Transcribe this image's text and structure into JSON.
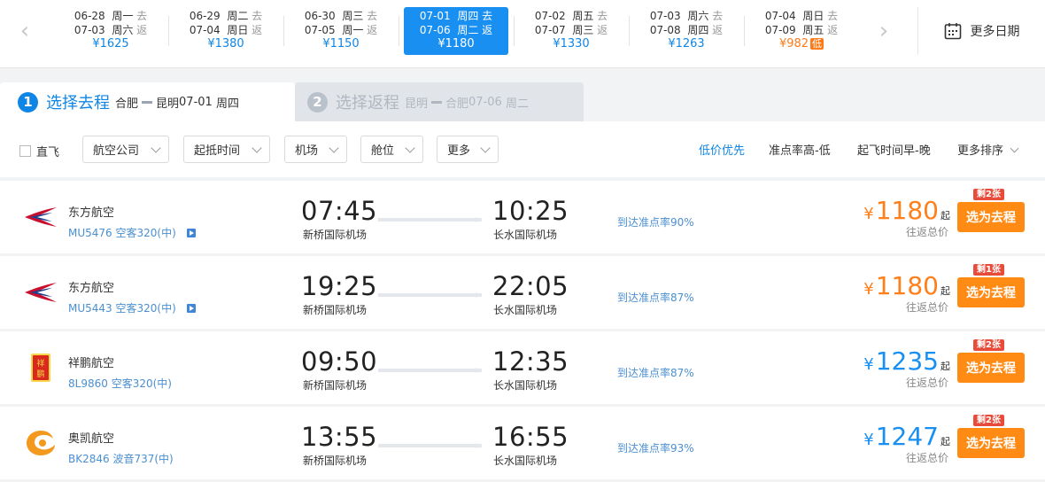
{
  "date_strip": {
    "items": [
      {
        "out_date": "06-28",
        "out_day": "周一",
        "out_dir": "去",
        "ret_date": "07-03",
        "ret_day": "周六",
        "ret_dir": "返",
        "price": "¥1625",
        "active": false,
        "low": false
      },
      {
        "out_date": "06-29",
        "out_day": "周二",
        "out_dir": "去",
        "ret_date": "07-04",
        "ret_day": "周日",
        "ret_dir": "返",
        "price": "¥1380",
        "active": false,
        "low": false
      },
      {
        "out_date": "06-30",
        "out_day": "周三",
        "out_dir": "去",
        "ret_date": "07-05",
        "ret_day": "周一",
        "ret_dir": "返",
        "price": "¥1150",
        "active": false,
        "low": false
      },
      {
        "out_date": "07-01",
        "out_day": "周四",
        "out_dir": "去",
        "ret_date": "07-06",
        "ret_day": "周二",
        "ret_dir": "返",
        "price": "¥1180",
        "active": true,
        "low": false
      },
      {
        "out_date": "07-02",
        "out_day": "周五",
        "out_dir": "去",
        "ret_date": "07-07",
        "ret_day": "周三",
        "ret_dir": "返",
        "price": "¥1330",
        "active": false,
        "low": false
      },
      {
        "out_date": "07-03",
        "out_day": "周六",
        "out_dir": "去",
        "ret_date": "07-08",
        "ret_day": "周四",
        "ret_dir": "返",
        "price": "¥1263",
        "active": false,
        "low": false
      },
      {
        "out_date": "07-04",
        "out_day": "周日",
        "out_dir": "去",
        "ret_date": "07-09",
        "ret_day": "周五",
        "ret_dir": "返",
        "price": "¥982",
        "active": false,
        "low": true,
        "low_label": "低"
      }
    ],
    "more_dates_label": "更多日期"
  },
  "steps": {
    "step1": {
      "num": "1",
      "title": "选择去程",
      "from": "合肥",
      "to": "昆明",
      "date": "07-01",
      "day": "周四"
    },
    "step2": {
      "num": "2",
      "title": "选择返程",
      "from": "昆明",
      "to": "合肥",
      "date": "07-06",
      "day": "周二"
    }
  },
  "filters": {
    "direct_label": "直飞",
    "buttons": [
      "航空公司",
      "起抵时间",
      "机场",
      "舱位",
      "更多"
    ],
    "sorts": [
      "低价优先",
      "准点率高-低",
      "起飞时间早-晚",
      "更多排序"
    ]
  },
  "flights": [
    {
      "airline": "东方航空",
      "flight_no": "MU5476",
      "aircraft": "空客320(中)",
      "has_video": true,
      "dep_time": "07:45",
      "dep_airport": "新桥国际机场",
      "arr_time": "10:25",
      "arr_airport": "长水国际机场",
      "ontime": "到达准点率90%",
      "price": "1180",
      "price_suffix": "起",
      "price_color": "orange",
      "price_note": "往返总价",
      "seats": "剩2张",
      "button": "选为去程",
      "logo": "china-eastern"
    },
    {
      "airline": "东方航空",
      "flight_no": "MU5443",
      "aircraft": "空客320(中)",
      "has_video": true,
      "dep_time": "19:25",
      "dep_airport": "新桥国际机场",
      "arr_time": "22:05",
      "arr_airport": "长水国际机场",
      "ontime": "到达准点率87%",
      "price": "1180",
      "price_suffix": "起",
      "price_color": "orange",
      "price_note": "往返总价",
      "seats": "剩1张",
      "button": "选为去程",
      "logo": "china-eastern"
    },
    {
      "airline": "祥鹏航空",
      "flight_no": "8L9860",
      "aircraft": "空客320(中)",
      "has_video": false,
      "dep_time": "09:50",
      "dep_airport": "新桥国际机场",
      "arr_time": "12:35",
      "arr_airport": "长水国际机场",
      "ontime": "到达准点率87%",
      "price": "1235",
      "price_suffix": "起",
      "price_color": "blue",
      "price_note": "往返总价",
      "seats": "剩2张",
      "button": "选为去程",
      "logo": "lucky-air"
    },
    {
      "airline": "奥凯航空",
      "flight_no": "BK2846",
      "aircraft": "波音737(中)",
      "has_video": false,
      "dep_time": "13:55",
      "dep_airport": "新桥国际机场",
      "arr_time": "16:55",
      "arr_airport": "长水国际机场",
      "ontime": "到达准点率93%",
      "price": "1247",
      "price_suffix": "起",
      "price_color": "blue",
      "price_note": "往返总价",
      "seats": "剩2张",
      "button": "选为去程",
      "logo": "okay-air"
    }
  ],
  "currency_symbol": "¥",
  "colors": {
    "primary": "#1a8ff2",
    "accent_orange": "#ff8a14",
    "low_price": "#ff7b1a",
    "badge_red": "#e84b3a"
  }
}
